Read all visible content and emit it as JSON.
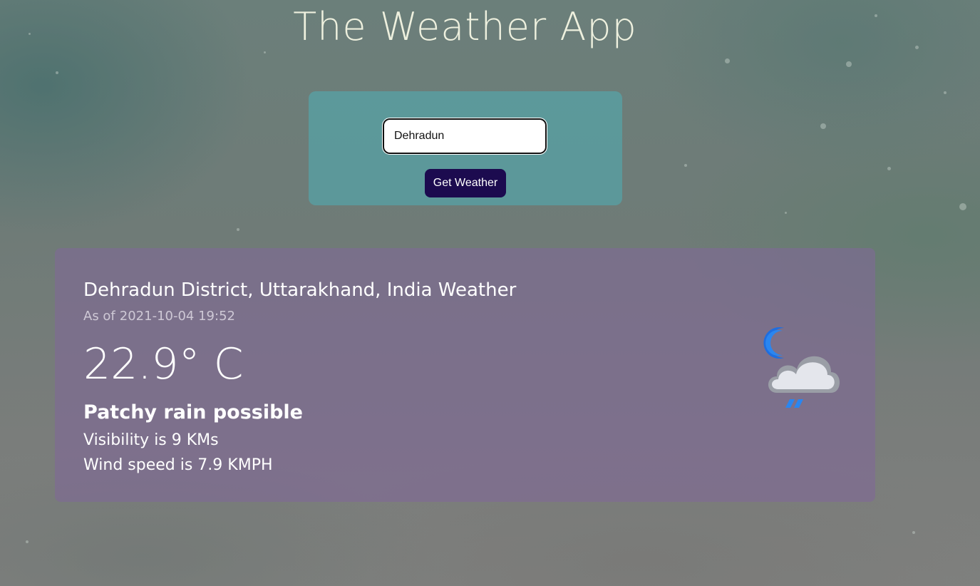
{
  "app": {
    "title": "The Weather App"
  },
  "search": {
    "value": "Dehradun",
    "button_label": "Get Weather"
  },
  "weather": {
    "location": "Dehradun District, Uttarakhand, India Weather",
    "as_of_label": "As of",
    "as_of_value": "2021-10-04 19:52",
    "temperature": "22.9",
    "temperature_unit": "° C",
    "condition": "Patchy rain possible",
    "visibility_text": "Visibility is 9 KMs",
    "wind_text": "Wind speed is 7.9 KMPH",
    "icon": "moon-cloud-rain-icon"
  },
  "colors": {
    "button_bg": "#1c0b4f",
    "panel_bg": "#56a3a8",
    "card_bg": "#806996",
    "title_color": "#eef0de"
  }
}
